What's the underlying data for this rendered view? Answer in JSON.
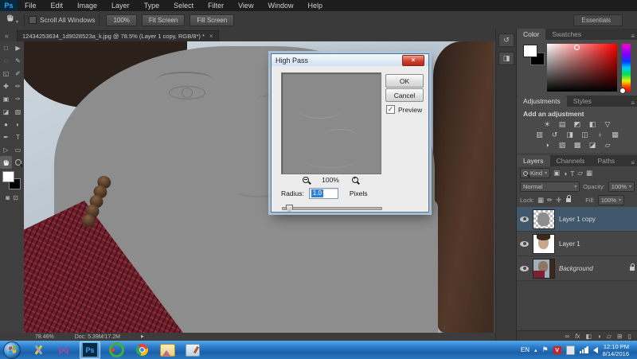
{
  "menu": {
    "logo": "Ps",
    "items": [
      "File",
      "Edit",
      "Image",
      "Layer",
      "Type",
      "Select",
      "Filter",
      "View",
      "Window",
      "Help"
    ]
  },
  "options": {
    "scroll_all_windows": "Scroll All Windows",
    "zoom_100": "100%",
    "fit_screen": "Fit Screen",
    "fill_screen": "Fill Screen",
    "workspace": "Essentials",
    "workspace_arrow": "▾"
  },
  "doc_tab": {
    "title": "12434253634_1d9028523a_k.jpg @ 78.5% (Layer 1 copy, RGB/8*) *",
    "close": "×"
  },
  "toolbar": {
    "collapse_chevron": "«",
    "tools": [
      {
        "name": "rectangular-marquee",
        "glyph": "□"
      },
      {
        "name": "move",
        "glyph": "▶"
      },
      {
        "name": "lasso",
        "glyph": "◌"
      },
      {
        "name": "quick-selection",
        "glyph": "✎"
      },
      {
        "name": "crop",
        "glyph": "◱"
      },
      {
        "name": "eyedropper",
        "glyph": "✐"
      },
      {
        "name": "spot-healing-brush",
        "glyph": "✚"
      },
      {
        "name": "brush",
        "glyph": "✏"
      },
      {
        "name": "clone-stamp",
        "glyph": "▣"
      },
      {
        "name": "history-brush",
        "glyph": "✑"
      },
      {
        "name": "eraser",
        "glyph": "◪"
      },
      {
        "name": "gradient",
        "glyph": "▧"
      },
      {
        "name": "blur",
        "glyph": "●"
      },
      {
        "name": "dodge",
        "glyph": "◐"
      },
      {
        "name": "pen",
        "glyph": "✒"
      },
      {
        "name": "type",
        "glyph": "T"
      },
      {
        "name": "path-selection",
        "glyph": "▷"
      },
      {
        "name": "rectangle-shape",
        "glyph": "▭"
      },
      {
        "name": "hand",
        "glyph": ""
      },
      {
        "name": "zoom",
        "glyph": ""
      }
    ]
  },
  "dialog": {
    "title": "High Pass",
    "close": "×",
    "ok": "OK",
    "cancel": "Cancel",
    "preview_check": "✓",
    "preview_label": "Preview",
    "zoom_level": "100%",
    "radius_label": "Radius:",
    "radius_value": "1.0",
    "units_label": "Pixels"
  },
  "status": {
    "zoom": "78.46%",
    "doc": "Doc: 5.39M/17.2M",
    "arrow": "▶"
  },
  "dock": {
    "icons": [
      {
        "name": "history-panel",
        "glyph": "↺"
      },
      {
        "name": "properties-panel",
        "glyph": "◨"
      }
    ]
  },
  "color_panel": {
    "tabs": [
      "Color",
      "Swatches"
    ],
    "menu_icon": "≡"
  },
  "adjustments_panel": {
    "tab_active": "Adjustments",
    "tab_inactive": "Styles",
    "heading": "Add an adjustment",
    "menu_icon": "≡",
    "icons_row1": [
      {
        "name": "brightness-contrast",
        "glyph": "☀"
      },
      {
        "name": "levels",
        "glyph": "▤"
      },
      {
        "name": "curves",
        "glyph": "◩"
      },
      {
        "name": "exposure",
        "glyph": "◧"
      },
      {
        "name": "vibrance",
        "glyph": "▽"
      }
    ],
    "icons_row2": [
      {
        "name": "hue-saturation",
        "glyph": "▥"
      },
      {
        "name": "color-balance",
        "glyph": "↺"
      },
      {
        "name": "black-white",
        "glyph": "◨"
      },
      {
        "name": "photo-filter",
        "glyph": "◫"
      },
      {
        "name": "channel-mixer",
        "glyph": "♁"
      },
      {
        "name": "color-lookup",
        "glyph": "▦"
      }
    ],
    "icons_row3": [
      {
        "name": "invert",
        "glyph": "◑"
      },
      {
        "name": "posterize",
        "glyph": "▨"
      },
      {
        "name": "threshold",
        "glyph": "▩"
      },
      {
        "name": "gradient-map",
        "glyph": "◪"
      },
      {
        "name": "selective-color",
        "glyph": "▱"
      }
    ]
  },
  "layers_panel": {
    "tabs": [
      "Layers",
      "Channels",
      "Paths"
    ],
    "menu_icon": "≡",
    "kind_label": "Kind",
    "dd_arrow": "▾",
    "filter_icons": [
      {
        "name": "filter-pixel-layers",
        "glyph": "▣"
      },
      {
        "name": "filter-adjustment-layers",
        "glyph": "◑"
      },
      {
        "name": "filter-type-layers",
        "glyph": "T"
      },
      {
        "name": "filter-shape-layers",
        "glyph": "▱"
      },
      {
        "name": "filter-smart-objects",
        "glyph": "▦"
      }
    ],
    "blend_mode": "Normal",
    "opacity_label": "Opacity:",
    "opacity_value": "100%",
    "lock_label": "Lock:",
    "lock_icons": [
      {
        "name": "lock-transparency",
        "glyph": "▦"
      },
      {
        "name": "lock-pixels",
        "glyph": "✏"
      },
      {
        "name": "lock-position",
        "glyph": "✛"
      }
    ],
    "fill_label": "Fill:",
    "fill_value": "100%",
    "items": [
      {
        "name": "Layer 1 copy",
        "selected": true
      },
      {
        "name": "Layer 1",
        "selected": false
      },
      {
        "name": "Background",
        "selected": false,
        "locked": true
      }
    ],
    "bottom_icons": [
      {
        "name": "link-layers",
        "glyph": "∞"
      },
      {
        "name": "layer-effects",
        "glyph": "fx"
      },
      {
        "name": "add-layer-mask",
        "glyph": "◧"
      },
      {
        "name": "new-adjustment-layer",
        "glyph": "◑"
      },
      {
        "name": "new-group",
        "glyph": "▱"
      },
      {
        "name": "new-layer",
        "glyph": "⊞"
      },
      {
        "name": "delete-layer",
        "glyph": "▯"
      }
    ]
  },
  "taskbar": {
    "language": "EN",
    "show_hidden_arrow": "▴",
    "flag_icon": "⚑",
    "v_badge": "V",
    "time": "12:10 PM",
    "date": "8/14/2016"
  },
  "colors": {
    "ps_accent_blue": "#31a8ff",
    "selection_blue": "#2f7fd6",
    "layer_selected": "#41576b",
    "taskbar_blue": "#2a7ccb",
    "close_button_red": "#d1402f"
  }
}
